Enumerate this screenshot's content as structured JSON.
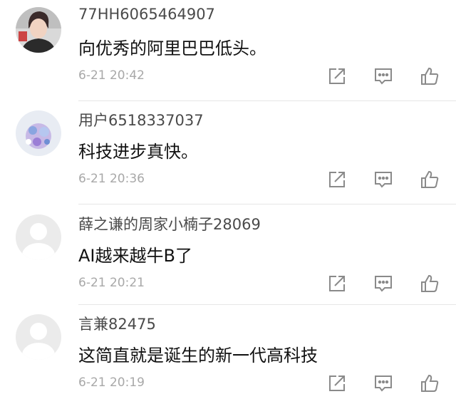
{
  "comments": [
    {
      "username": "77HH6065464907",
      "content": "向优秀的阿里巴巴低头。",
      "time": "6-21 20:42",
      "avatar": "photo-avatar-person"
    },
    {
      "username": "用户6518337037",
      "content": "科技进步真快。",
      "time": "6-21 20:36",
      "avatar": "photo-avatar-flowers"
    },
    {
      "username": "薛之谦的周家小楠子28069",
      "content": "AI越来越牛B了",
      "time": "6-21 20:21",
      "avatar": "default-avatar"
    },
    {
      "username": "言兼82475",
      "content": "这简直就是诞生的新一代高科技",
      "time": "6-21 20:19",
      "avatar": "default-avatar"
    }
  ],
  "icons": {
    "share": "share-icon",
    "reply": "comment-reply-icon",
    "like": "thumbs-up-icon"
  },
  "colors": {
    "username": "#4a4a4a",
    "content": "#111111",
    "timestamp": "#a8a8a8",
    "icon": "#8a8a8a",
    "divider": "#e6e6e6"
  }
}
